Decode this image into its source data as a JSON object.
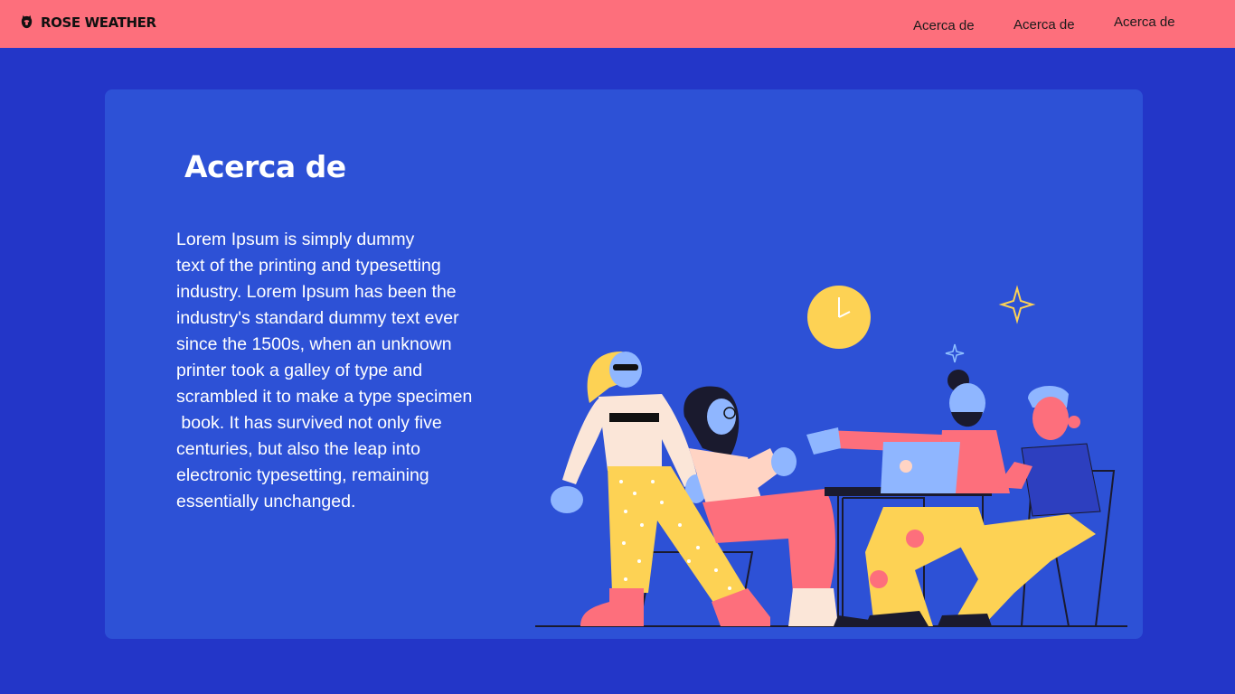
{
  "header": {
    "brand": "ROSE WEATHER",
    "logo_icon": "rose-icon",
    "nav": [
      "Acerca de",
      "Acerca de",
      "Acerca de"
    ]
  },
  "about": {
    "title": "Acerca de",
    "body_lines": [
      "Lorem Ipsum is simply dummy",
      "text of the printing and typesetting",
      "industry. Lorem Ipsum has been the",
      "industry's standard dummy text ever",
      "since the 1500s, when an unknown",
      "printer took a galley of type and",
      "scrambled it to make a type specimen",
      " book. It has survived not only five",
      "centuries, but also the leap into",
      "electronic typesetting, remaining",
      "essentially unchanged."
    ]
  },
  "colors": {
    "page_background": "#2336c8",
    "header_background": "#fd6f7c",
    "card_background": "#2d51d6",
    "text": "#ffffff"
  }
}
